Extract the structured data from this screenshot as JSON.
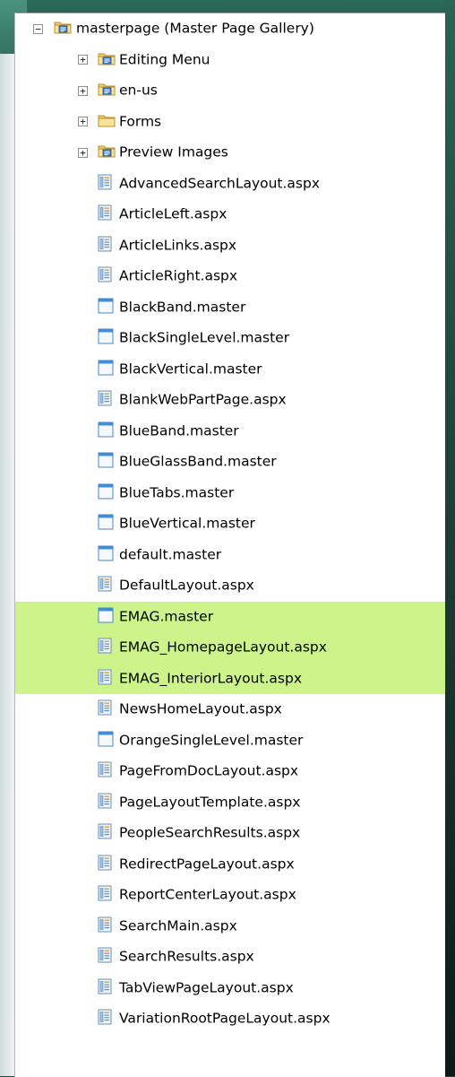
{
  "tree": {
    "root": {
      "label": "masterpage (Master Page Gallery)",
      "expander": "−",
      "icon": "document-library-folder-icon"
    },
    "folders": [
      {
        "label": "Editing Menu",
        "expander": "+",
        "icon": "document-library-folder-icon"
      },
      {
        "label": "en-us",
        "expander": "+",
        "icon": "document-library-folder-icon"
      },
      {
        "label": "Forms",
        "expander": "+",
        "icon": "folder-icon"
      },
      {
        "label": "Preview Images",
        "expander": "+",
        "icon": "document-library-folder-icon"
      }
    ],
    "files": [
      {
        "label": "AdvancedSearchLayout.aspx",
        "icon": "aspx-page-icon",
        "highlighted": false
      },
      {
        "label": "ArticleLeft.aspx",
        "icon": "aspx-page-icon",
        "highlighted": false
      },
      {
        "label": "ArticleLinks.aspx",
        "icon": "aspx-page-icon",
        "highlighted": false
      },
      {
        "label": "ArticleRight.aspx",
        "icon": "aspx-page-icon",
        "highlighted": false
      },
      {
        "label": "BlackBand.master",
        "icon": "master-page-icon",
        "highlighted": false
      },
      {
        "label": "BlackSingleLevel.master",
        "icon": "master-page-icon",
        "highlighted": false
      },
      {
        "label": "BlackVertical.master",
        "icon": "master-page-icon",
        "highlighted": false
      },
      {
        "label": "BlankWebPartPage.aspx",
        "icon": "aspx-page-icon",
        "highlighted": false
      },
      {
        "label": "BlueBand.master",
        "icon": "master-page-icon",
        "highlighted": false
      },
      {
        "label": "BlueGlassBand.master",
        "icon": "master-page-icon",
        "highlighted": false
      },
      {
        "label": "BlueTabs.master",
        "icon": "master-page-icon",
        "highlighted": false
      },
      {
        "label": "BlueVertical.master",
        "icon": "master-page-icon",
        "highlighted": false
      },
      {
        "label": "default.master",
        "icon": "master-page-icon",
        "highlighted": false
      },
      {
        "label": "DefaultLayout.aspx",
        "icon": "aspx-page-icon",
        "highlighted": false
      },
      {
        "label": "EMAG.master",
        "icon": "master-page-icon",
        "highlighted": true
      },
      {
        "label": "EMAG_HomepageLayout.aspx",
        "icon": "aspx-page-icon",
        "highlighted": true
      },
      {
        "label": "EMAG_InteriorLayout.aspx",
        "icon": "aspx-page-icon",
        "highlighted": true
      },
      {
        "label": "NewsHomeLayout.aspx",
        "icon": "aspx-page-icon",
        "highlighted": false
      },
      {
        "label": "OrangeSingleLevel.master",
        "icon": "master-page-icon",
        "highlighted": false
      },
      {
        "label": "PageFromDocLayout.aspx",
        "icon": "aspx-page-icon",
        "highlighted": false
      },
      {
        "label": "PageLayoutTemplate.aspx",
        "icon": "aspx-page-icon",
        "highlighted": false
      },
      {
        "label": "PeopleSearchResults.aspx",
        "icon": "aspx-page-icon",
        "highlighted": false
      },
      {
        "label": "RedirectPageLayout.aspx",
        "icon": "aspx-page-icon",
        "highlighted": false
      },
      {
        "label": "ReportCenterLayout.aspx",
        "icon": "aspx-page-icon",
        "highlighted": false
      },
      {
        "label": "SearchMain.aspx",
        "icon": "aspx-page-icon",
        "highlighted": false
      },
      {
        "label": "SearchResults.aspx",
        "icon": "aspx-page-icon",
        "highlighted": false
      },
      {
        "label": "TabViewPageLayout.aspx",
        "icon": "aspx-page-icon",
        "highlighted": false
      },
      {
        "label": "VariationRootPageLayout.aspx",
        "icon": "aspx-page-icon",
        "highlighted": false
      }
    ]
  },
  "colors": {
    "highlight": "#ccf48b",
    "background_teal": "#1f4a3f",
    "folder_yellow": "#f6d77a",
    "master_blue": "#3c8fe0"
  }
}
